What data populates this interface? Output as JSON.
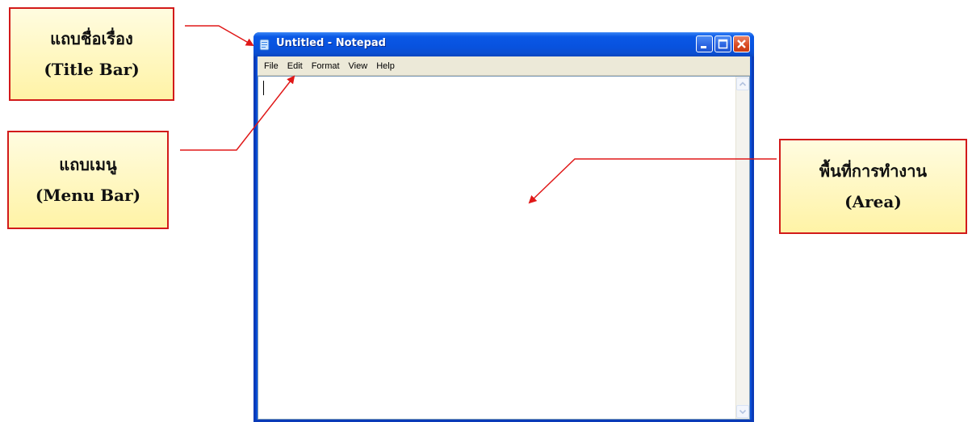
{
  "callouts": {
    "title_bar": {
      "thai": "แถบชื่อเรื่อง",
      "english": "(Title Bar)"
    },
    "menu_bar": {
      "thai": "แถบเมนู",
      "english": "(Menu Bar)"
    },
    "area": {
      "thai": "พื้นที่การทำงาน",
      "english": "(Area)"
    }
  },
  "window": {
    "title": "Untitled - Notepad",
    "menu": [
      "File",
      "Edit",
      "Format",
      "View",
      "Help"
    ],
    "editor_text": ""
  },
  "colors": {
    "callout_border": "#d21a1a",
    "callout_fill": "#fff3a6",
    "arrow": "#e01818",
    "titlebar": "#0852de",
    "menubar": "#ece9d8"
  },
  "icons": [
    "notepad-icon",
    "minimize-icon",
    "maximize-icon",
    "close-icon",
    "scroll-up-icon",
    "scroll-down-icon"
  ]
}
